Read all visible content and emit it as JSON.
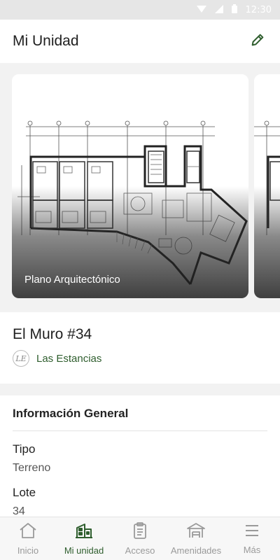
{
  "status_bar": {
    "time": "12:30"
  },
  "header": {
    "title": "Mi Unidad"
  },
  "carousel": {
    "cards": [
      {
        "caption": "Plano Arquitectónico"
      }
    ]
  },
  "unit": {
    "name": "El Muro #34",
    "development": "Las Estancias",
    "logo_text": "LE"
  },
  "info": {
    "title": "Información General",
    "fields": [
      {
        "label": "Tipo",
        "value": "Terreno"
      },
      {
        "label": "Lote",
        "value": "34"
      }
    ]
  },
  "nav": {
    "items": [
      {
        "label": "Inicio",
        "icon": "home-icon"
      },
      {
        "label": "Mi unidad",
        "icon": "building-icon"
      },
      {
        "label": "Acceso",
        "icon": "clipboard-icon"
      },
      {
        "label": "Amenidades",
        "icon": "pavilion-icon"
      },
      {
        "label": "Más",
        "icon": "menu-icon"
      }
    ]
  },
  "colors": {
    "accent": "#2f5e2e",
    "inactive": "#9a9a9a"
  }
}
